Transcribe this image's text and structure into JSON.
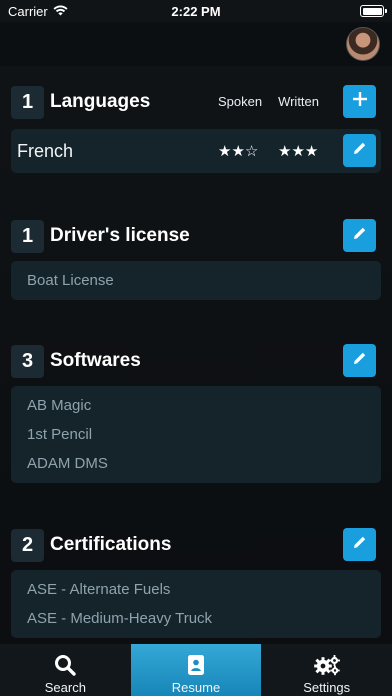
{
  "status": {
    "carrier": "Carrier",
    "time": "2:22 PM"
  },
  "languages": {
    "count": "1",
    "title": "Languages",
    "col_spoken": "Spoken",
    "col_written": "Written",
    "items": [
      {
        "name": "French",
        "spoken_stars": "★★☆",
        "written_stars": "★★★",
        "spoken_rating": 2,
        "written_rating": 3,
        "max_rating": 3
      }
    ]
  },
  "drivers_license": {
    "count": "1",
    "title": "Driver's license",
    "items": [
      "Boat License"
    ]
  },
  "softwares": {
    "count": "3",
    "title": "Softwares",
    "items": [
      "AB Magic",
      "1st Pencil",
      "ADAM DMS"
    ]
  },
  "certifications": {
    "count": "2",
    "title": "Certifications",
    "items": [
      "ASE - Alternate Fuels",
      "ASE - Medium-Heavy Truck"
    ]
  },
  "tabs": [
    {
      "label": "Search",
      "icon": "search-icon",
      "active": false
    },
    {
      "label": "Resume",
      "icon": "resume-icon",
      "active": true
    },
    {
      "label": "Settings",
      "icon": "gears-icon",
      "active": false
    }
  ],
  "colors": {
    "accent": "#1a9fde",
    "panel": "#15232b",
    "muted_text": "#8fa3ad"
  }
}
